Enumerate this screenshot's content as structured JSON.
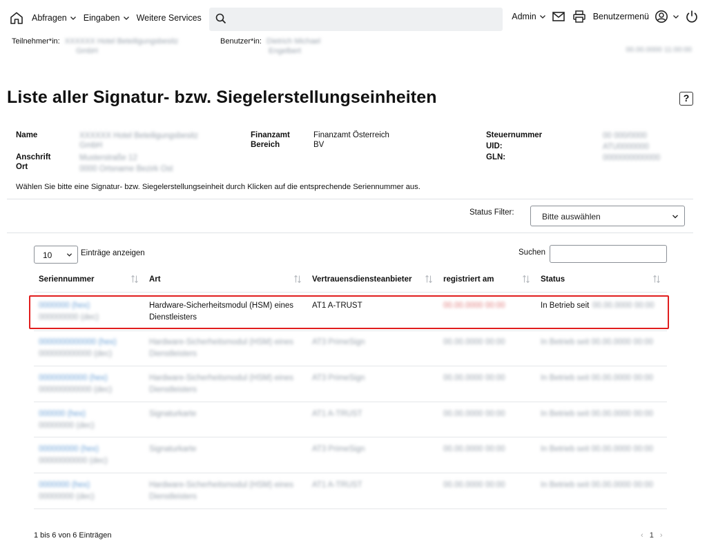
{
  "nav": {
    "abfragen": "Abfragen",
    "eingaben": "Eingaben",
    "weitere": "Weitere Services",
    "admin": "Admin",
    "benutzermenu": "Benutzermenü",
    "search_value": ""
  },
  "session": {
    "teilnehmer_label": "Teilnehmer*in:",
    "teilnehmer_value_1": "XXXXXX Hotel Beteiligungsbesitz",
    "teilnehmer_value_2": "GmbH",
    "benutzer_label": "Benutzer*in:",
    "benutzer_value_1": "Dietrich Michael",
    "benutzer_value_2": "Engelbert",
    "datetime": "00.00.0000 11:00:00"
  },
  "page": {
    "title": "Liste aller Signatur- bzw. Siegelerstellungseinheiten",
    "help": "?"
  },
  "info": {
    "name_label": "Name",
    "name_value_1": "XXXXXX Hotel Beteiligungsbesitz",
    "name_value_2": "GmbH",
    "anschrift_label": "Anschrift",
    "anschrift_value": "Musterstraße 12",
    "ort_label": "Ort",
    "ort_value": "0000 Ortsname Bezirk Ost",
    "finanzamt_label": "Finanzamt",
    "finanzamt_value": "Finanzamt Österreich",
    "bereich_label": "Bereich",
    "bereich_value": "BV",
    "steuernummer_label": "Steuernummer",
    "steuernummer_value": "00 000/0000",
    "uid_label": "UID:",
    "uid_value": "ATU0000000",
    "gln_label": "GLN:",
    "gln_value": "0000000000000"
  },
  "instruction": "Wählen Sie bitte eine Signatur- bzw. Siegelerstellungseinheit durch Klicken auf die entsprechende Seriennummer aus.",
  "filter": {
    "label": "Status Filter:",
    "placeholder": "Bitte auswählen"
  },
  "table_controls": {
    "length_value": "10",
    "length_label": "Einträge anzeigen",
    "search_label": "Suchen"
  },
  "table": {
    "headers": [
      "Seriennummer",
      "Art",
      "Vertrauensdiensteanbieter",
      "registriert am",
      "Status"
    ],
    "rows": [
      {
        "serial_1": "0000000 (hex)",
        "serial_2": "000000000 (dec)",
        "art_1": "Hardware-Sicherheitsmodul (HSM) eines",
        "art_2": "Dienstleisters",
        "vda": "AT1 A-TRUST",
        "registered": "00.00.0000 00:00",
        "status": "In Betrieb seit",
        "status_date": "00.00.0000 00:00"
      },
      {
        "serial_1": "0000000000000 (hex)",
        "serial_2": "000000000000 (dec)",
        "art_1": "Hardware-Sicherheitsmodul (HSM) eines",
        "art_2": "Dienstleisters",
        "vda": "AT3 PrimeSign",
        "registered": "00.00.0000 00:00",
        "status": "In Betrieb seit 00.00.0000 00:00",
        "status_date": ""
      },
      {
        "serial_1": "00000000000 (hex)",
        "serial_2": "000000000000 (dec)",
        "art_1": "Hardware-Sicherheitsmodul (HSM) eines",
        "art_2": "Dienstleisters",
        "vda": "AT3 PrimeSign",
        "registered": "00.00.0000 00:00",
        "status": "In Betrieb seit 00.00.0000 00:00",
        "status_date": ""
      },
      {
        "serial_1": "000000 (hex)",
        "serial_2": "00000000 (dec)",
        "art_1": "Signaturkarte",
        "art_2": "",
        "vda": "AT1 A-TRUST",
        "registered": "00.00.0000 00:00",
        "status": "In Betrieb seit 00.00.0000 00:00",
        "status_date": ""
      },
      {
        "serial_1": "000000000 (hex)",
        "serial_2": "00000000000 (dec)",
        "art_1": "Signaturkarte",
        "art_2": "",
        "vda": "AT3 PrimeSign",
        "registered": "00.00.0000 00:00",
        "status": "In Betrieb seit 00.00.0000 00:00",
        "status_date": ""
      },
      {
        "serial_1": "0000000 (hex)",
        "serial_2": "00000000 (dec)",
        "art_1": "Hardware-Sicherheitsmodul (HSM) eines",
        "art_2": "Dienstleisters",
        "vda": "AT1 A-TRUST",
        "registered": "00.00.0000 00:00",
        "status": "In Betrieb seit 00.00.0000 00:00",
        "status_date": ""
      }
    ]
  },
  "footer": {
    "info": "1 bis 6 von 6 Einträgen",
    "prev": "‹",
    "page": "1",
    "next": "›"
  }
}
